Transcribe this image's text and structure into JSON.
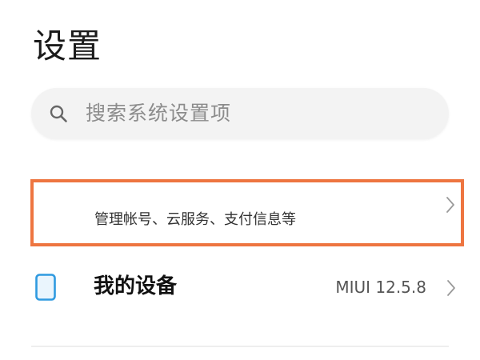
{
  "page": {
    "title": "设置"
  },
  "search": {
    "icon": "search-icon",
    "placeholder": "搜索系统设置项"
  },
  "account": {
    "subtitle": "管理帐号、云服务、支付信息等",
    "chevron_icon": "chevron-right-icon",
    "highlight_color": "#ee7540"
  },
  "device": {
    "icon": "phone-icon",
    "icon_color": "#2f9ae0",
    "label": "我的设备",
    "version": "MIUI 12.5.8",
    "chevron_icon": "chevron-right-icon"
  }
}
